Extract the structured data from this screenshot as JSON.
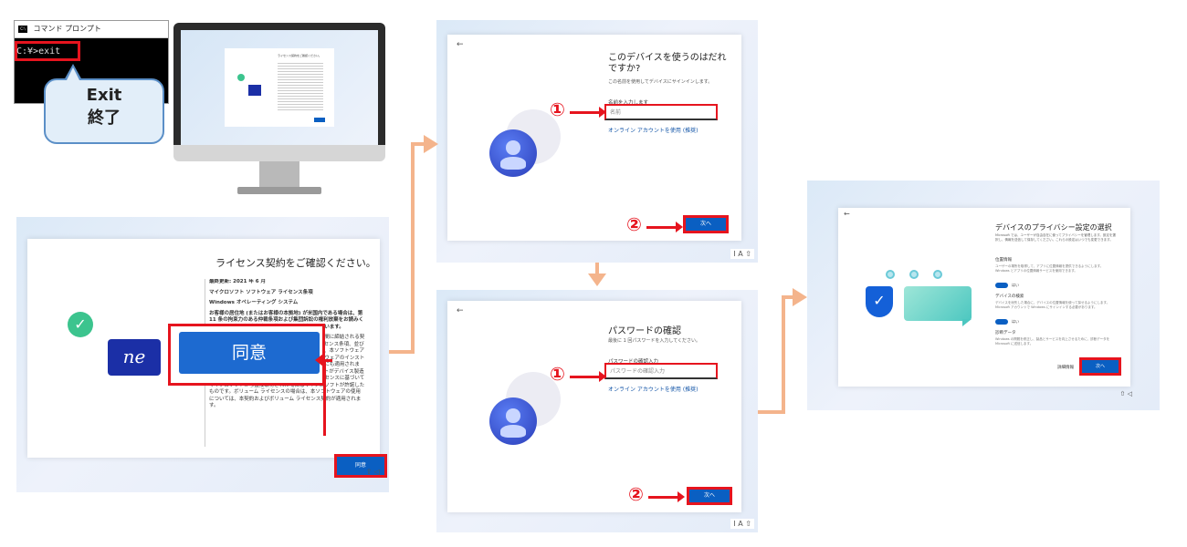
{
  "cmd": {
    "title": "コマンド プロンプト",
    "icon_text": "C:\\",
    "command": "C:¥>exit",
    "callout_en": "Exit",
    "callout_jp": "終了"
  },
  "monitor": {
    "mini_title": "ライセンス契約をご確認ください。"
  },
  "license": {
    "title": "ライセンス契約をご確認ください。",
    "updated": "最終更新: 2021 年 6 月",
    "terms_title": "マイクロソフト ソフトウェア ライセンス条項",
    "os_name": "Windows オペレーティング システム",
    "bold_para": "お客様の居住地 (またはお客様の本拠地) が米国内である場合は、第 11 条の拘束力のある仲裁条項および集団訴訟の権利放棄をお読みください。紛争の解決方法に影響する条項が含まれています。",
    "body_para": "本ライセンス条項は、お客様とマイクロソフトとの間に締結される契約です。本ソフトウェアの使用に関しては、本ライセンス条項、並びにお客様の居住地の法令が適用されます。本条項は、本ソフトウェアと共に提供されるデバイスの製造業者またはソフトウェアのインストーラーが、お客様に本ソフトウェアを配布した場合にも適用されます。以下に記載されるライセンスは、マイクロソフトがデバイス製造業者に許諾したもの、または以下に記載されたライセンスに基づいてマイクロソフトから直接取得された場合はマイクロソフトが許諾したものです。ボリューム ライセンスの場合は、本ソフトウェアの使用については、本契約およびボリューム ライセンス契約が適用されます。",
    "zoom_label": "同意",
    "accept_label": "同意"
  },
  "who": {
    "title": "このデバイスを使うのはだれですか?",
    "subtitle": "この名前を使用してデバイスにサインインします。",
    "field_label": "名前を入力します",
    "placeholder": "名前",
    "online_link": "オンライン アカウントを使用 (推奨)",
    "next_label": "次へ",
    "mark1": "①",
    "mark2": "②"
  },
  "password": {
    "title": "パスワードの確認",
    "subtitle": "最後に 1 回パスワードを入力してください。",
    "field_label": "パスワードの確認入力",
    "placeholder": "パスワードの確認入力",
    "online_link": "オンライン アカウントを使用 (推奨)",
    "next_label": "次へ",
    "mark1": "①",
    "mark2": "②"
  },
  "privacy": {
    "title": "デバイスのプライバシー設定の選択",
    "intro": "Microsoft では、ユーザーが自由自在に使ってプライバシーを管理します。設定を選択し、情報を送信して保存してください。これらの設定はいつでも変更できます。",
    "loc_title": "位置情報",
    "loc_text": "ユーザーの場所を取得して、アプリに位置情報を提供できるようにします。Windows とアプリの位置情報サービスを使用できます。",
    "toggle1": "はい",
    "find_title": "デバイスの検索",
    "find_text": "デバイスを紛失した場合に、デバイスの位置情報を使って探せるようにします。Microsoft アカウントで Windows にサインインする必要があります。",
    "toggle2": "はい",
    "diag_title": "診断データ",
    "diag_text": "Windows の問題を修正し、製品とサービスを向上させるために、診断データを Microsoft に送信します。",
    "more_label": "詳細情報",
    "next_label": "次へ"
  },
  "colors": {
    "accent": "#0a5fc2",
    "highlight": "#e6141e",
    "flow": "#f4b48c"
  }
}
